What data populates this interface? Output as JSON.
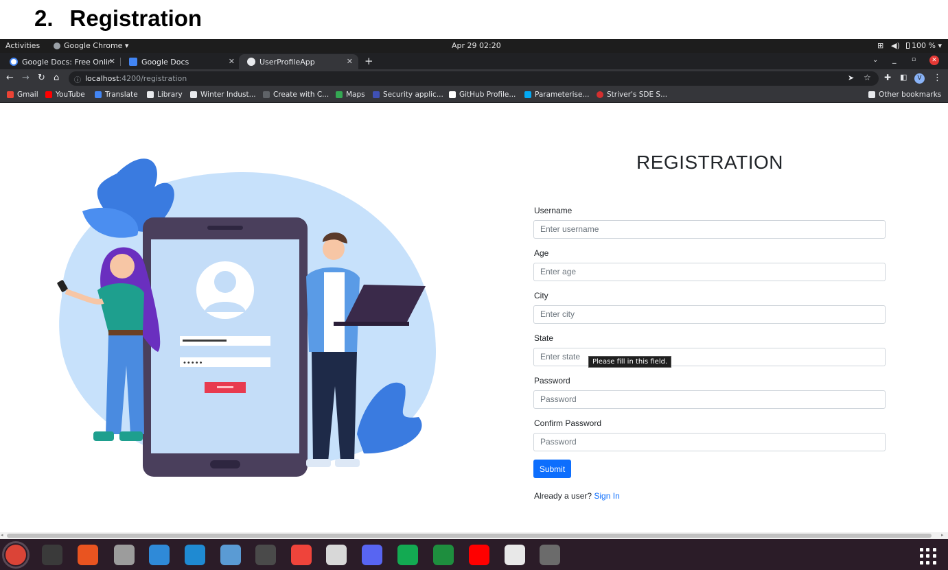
{
  "doc_heading": {
    "number": "2.",
    "title": "Registration"
  },
  "topbar": {
    "activities": "Activities",
    "app": "Google Chrome ▾",
    "datetime": "Apr 29  02:20",
    "battery": "100 % ▾"
  },
  "tabs": [
    {
      "label": "Google Docs: Free Online",
      "close": "✕"
    },
    {
      "label": "Google Docs"
    },
    {
      "label": "UserProfileApp",
      "close": "✕"
    }
  ],
  "new_tab": "+",
  "address": {
    "host": "localhost",
    "path": ":4200/registration"
  },
  "bookmarks": [
    {
      "label": "Gmail",
      "color": "#ea4335"
    },
    {
      "label": "YouTube",
      "color": "#ff0000"
    },
    {
      "label": "Translate",
      "color": "#4285f4"
    },
    {
      "label": "Library",
      "color": "#e8eaed"
    },
    {
      "label": "Winter Indust...",
      "color": "#e8eaed"
    },
    {
      "label": "Create with C...",
      "color": "#202124"
    },
    {
      "label": "Maps",
      "color": "#34a853"
    },
    {
      "label": "Security applic...",
      "color": "#3f51b5"
    },
    {
      "label": "GitHub Profile...",
      "color": "#ffffff"
    },
    {
      "label": "Parameterise...",
      "color": "#03a9f4"
    },
    {
      "label": "Striver's SDE S...",
      "color": "#d32f2f"
    }
  ],
  "other_bookmarks": "Other bookmarks",
  "form": {
    "title": "REGISTRATION",
    "fields": [
      {
        "label": "Username",
        "placeholder": "Enter username"
      },
      {
        "label": "Age",
        "placeholder": "Enter age"
      },
      {
        "label": "City",
        "placeholder": "Enter city"
      },
      {
        "label": "State",
        "placeholder": "Enter state"
      },
      {
        "label": "Password",
        "placeholder": "Password"
      },
      {
        "label": "Confirm Password",
        "placeholder": "Password"
      }
    ],
    "tooltip": "Please fill in this field.",
    "submit": "Submit",
    "already": "Already a user?",
    "signin": "Sign In"
  },
  "dock": [
    {
      "name": "chrome-icon",
      "color": "#db4437"
    },
    {
      "name": "terminal-icon",
      "color": "#3a3a3a"
    },
    {
      "name": "software-center-icon",
      "color": "#e95420"
    },
    {
      "name": "files-icon",
      "color": "#9c9c9c"
    },
    {
      "name": "help-icon",
      "color": "#2f8ad8"
    },
    {
      "name": "vscode-icon",
      "color": "#1f8ad2"
    },
    {
      "name": "text-editor-doc-icon",
      "color": "#5a9bd4"
    },
    {
      "name": "system-monitor-icon",
      "color": "#4a4a4a"
    },
    {
      "name": "anydesk-icon",
      "color": "#ef443b"
    },
    {
      "name": "document-viewer-icon",
      "color": "#d8d8d8"
    },
    {
      "name": "discord-icon",
      "color": "#5865f2"
    },
    {
      "name": "mongodb-compass-icon",
      "color": "#13aa52"
    },
    {
      "name": "hangouts-chat-icon",
      "color": "#1e8e3e"
    },
    {
      "name": "youtube-icon",
      "color": "#ff0000"
    },
    {
      "name": "gedit-icon",
      "color": "#e8e8e8"
    },
    {
      "name": "usb-drive-icon",
      "color": "#6b6b6b"
    }
  ]
}
